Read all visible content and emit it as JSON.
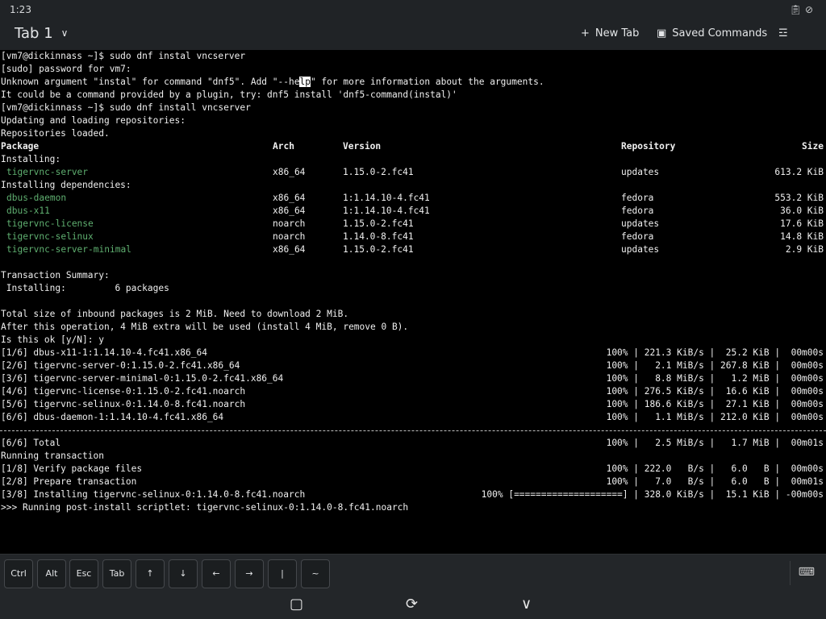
{
  "status_bar": {
    "time": "1:23"
  },
  "tab_bar": {
    "tab_label": "Tab 1",
    "new_tab_label": "New Tab",
    "saved_commands_label": "Saved Commands"
  },
  "terminal": {
    "line1": "[vm7@dickinnass ~]$ sudo dnf instal vncserver",
    "line2": "[sudo] password for vm7:",
    "line3_pre": "Unknown argument \"instal\" for command \"dnf5\". Add \"--he",
    "line3_sel": "lp",
    "line3_post": "\" for more information about the arguments.",
    "line4": "It could be a command provided by a plugin, try: dnf5 install 'dnf5-command(instal)'",
    "line5": "[vm7@dickinnass ~]$ sudo dnf install vncserver",
    "line6": "Updating and loading repositories:",
    "line7": "Repositories loaded.",
    "pkg_table": {
      "headers": {
        "package": "Package",
        "arch": "Arch",
        "version": "Version",
        "repository": "Repository",
        "size": "Size"
      },
      "installing_label": "Installing:",
      "deps_label": "Installing dependencies:",
      "rows": [
        {
          "name": "tigervnc-server",
          "arch": "x86_64",
          "version": "1.15.0-2.fc41",
          "repo": "updates",
          "size": "613.2 KiB"
        },
        {
          "name": "dbus-daemon",
          "arch": "x86_64",
          "version": "1:1.14.10-4.fc41",
          "repo": "fedora",
          "size": "553.2 KiB"
        },
        {
          "name": "dbus-x11",
          "arch": "x86_64",
          "version": "1:1.14.10-4.fc41",
          "repo": "fedora",
          "size": "36.0 KiB"
        },
        {
          "name": "tigervnc-license",
          "arch": "noarch",
          "version": "1.15.0-2.fc41",
          "repo": "updates",
          "size": "17.6 KiB"
        },
        {
          "name": "tigervnc-selinux",
          "arch": "noarch",
          "version": "1.14.0-8.fc41",
          "repo": "fedora",
          "size": "14.8 KiB"
        },
        {
          "name": "tigervnc-server-minimal",
          "arch": "x86_64",
          "version": "1.15.0-2.fc41",
          "repo": "updates",
          "size": "2.9 KiB"
        }
      ]
    },
    "summary_title": "Transaction Summary:",
    "summary_line": " Installing:         6 packages",
    "total_size": "Total size of inbound packages is 2 MiB. Need to download 2 MiB.",
    "after_op": "After this operation, 4 MiB extra will be used (install 4 MiB, remove 0 B).",
    "confirm": "Is this ok [y/N]: y",
    "downloads": [
      {
        "left": "[1/6] dbus-x11-1:1.14.10-4.fc41.x86_64",
        "right": "100% | 221.3 KiB/s |  25.2 KiB |  00m00s"
      },
      {
        "left": "[2/6] tigervnc-server-0:1.15.0-2.fc41.x86_64",
        "right": "100% |   2.1 MiB/s | 267.8 KiB |  00m00s"
      },
      {
        "left": "[3/6] tigervnc-server-minimal-0:1.15.0-2.fc41.x86_64",
        "right": "100% |   8.8 MiB/s |   1.2 MiB |  00m00s"
      },
      {
        "left": "[4/6] tigervnc-license-0:1.15.0-2.fc41.noarch",
        "right": "100% | 276.5 KiB/s |  16.6 KiB |  00m00s"
      },
      {
        "left": "[5/6] tigervnc-selinux-0:1.14.0-8.fc41.noarch",
        "right": "100% | 186.6 KiB/s |  27.1 KiB |  00m00s"
      },
      {
        "left": "[6/6] dbus-daemon-1:1.14.10-4.fc41.x86_64",
        "right": "100% |   1.1 MiB/s | 212.0 KiB |  00m00s"
      }
    ],
    "total_left": "[6/6] Total",
    "total_right": "100% |   2.5 MiB/s |   1.7 MiB |  00m01s",
    "running": "Running transaction",
    "steps": [
      {
        "left": "[1/8] Verify package files",
        "right": "100% | 222.0   B/s |   6.0   B |  00m00s"
      },
      {
        "left": "[2/8] Prepare transaction",
        "right": "100% |   7.0   B/s |   6.0   B |  00m01s"
      },
      {
        "left": "[3/8] Installing tigervnc-selinux-0:1.14.0-8.fc41.noarch",
        "right": "100% [====================] | 328.0 KiB/s |  15.1 KiB | -00m00s"
      }
    ],
    "scriptlet": ">>> Running post-install scriptlet: tigervnc-selinux-0:1.14.0-8.fc41.noarch"
  },
  "keys": [
    "Ctrl",
    "Alt",
    "Esc",
    "Tab",
    "↑",
    "↓",
    "←",
    "→",
    "|",
    "~"
  ],
  "icons": {
    "status": [
      "clipboard-icon",
      "mute-icon"
    ],
    "new_tab": "plus-icon",
    "saved_commands": "terminal-icon",
    "settings": "sliders-icon",
    "keyboard": "keyboard-icon",
    "nav": [
      "overview-square-icon",
      "rotate-icon",
      "chevron-down-icon"
    ]
  }
}
